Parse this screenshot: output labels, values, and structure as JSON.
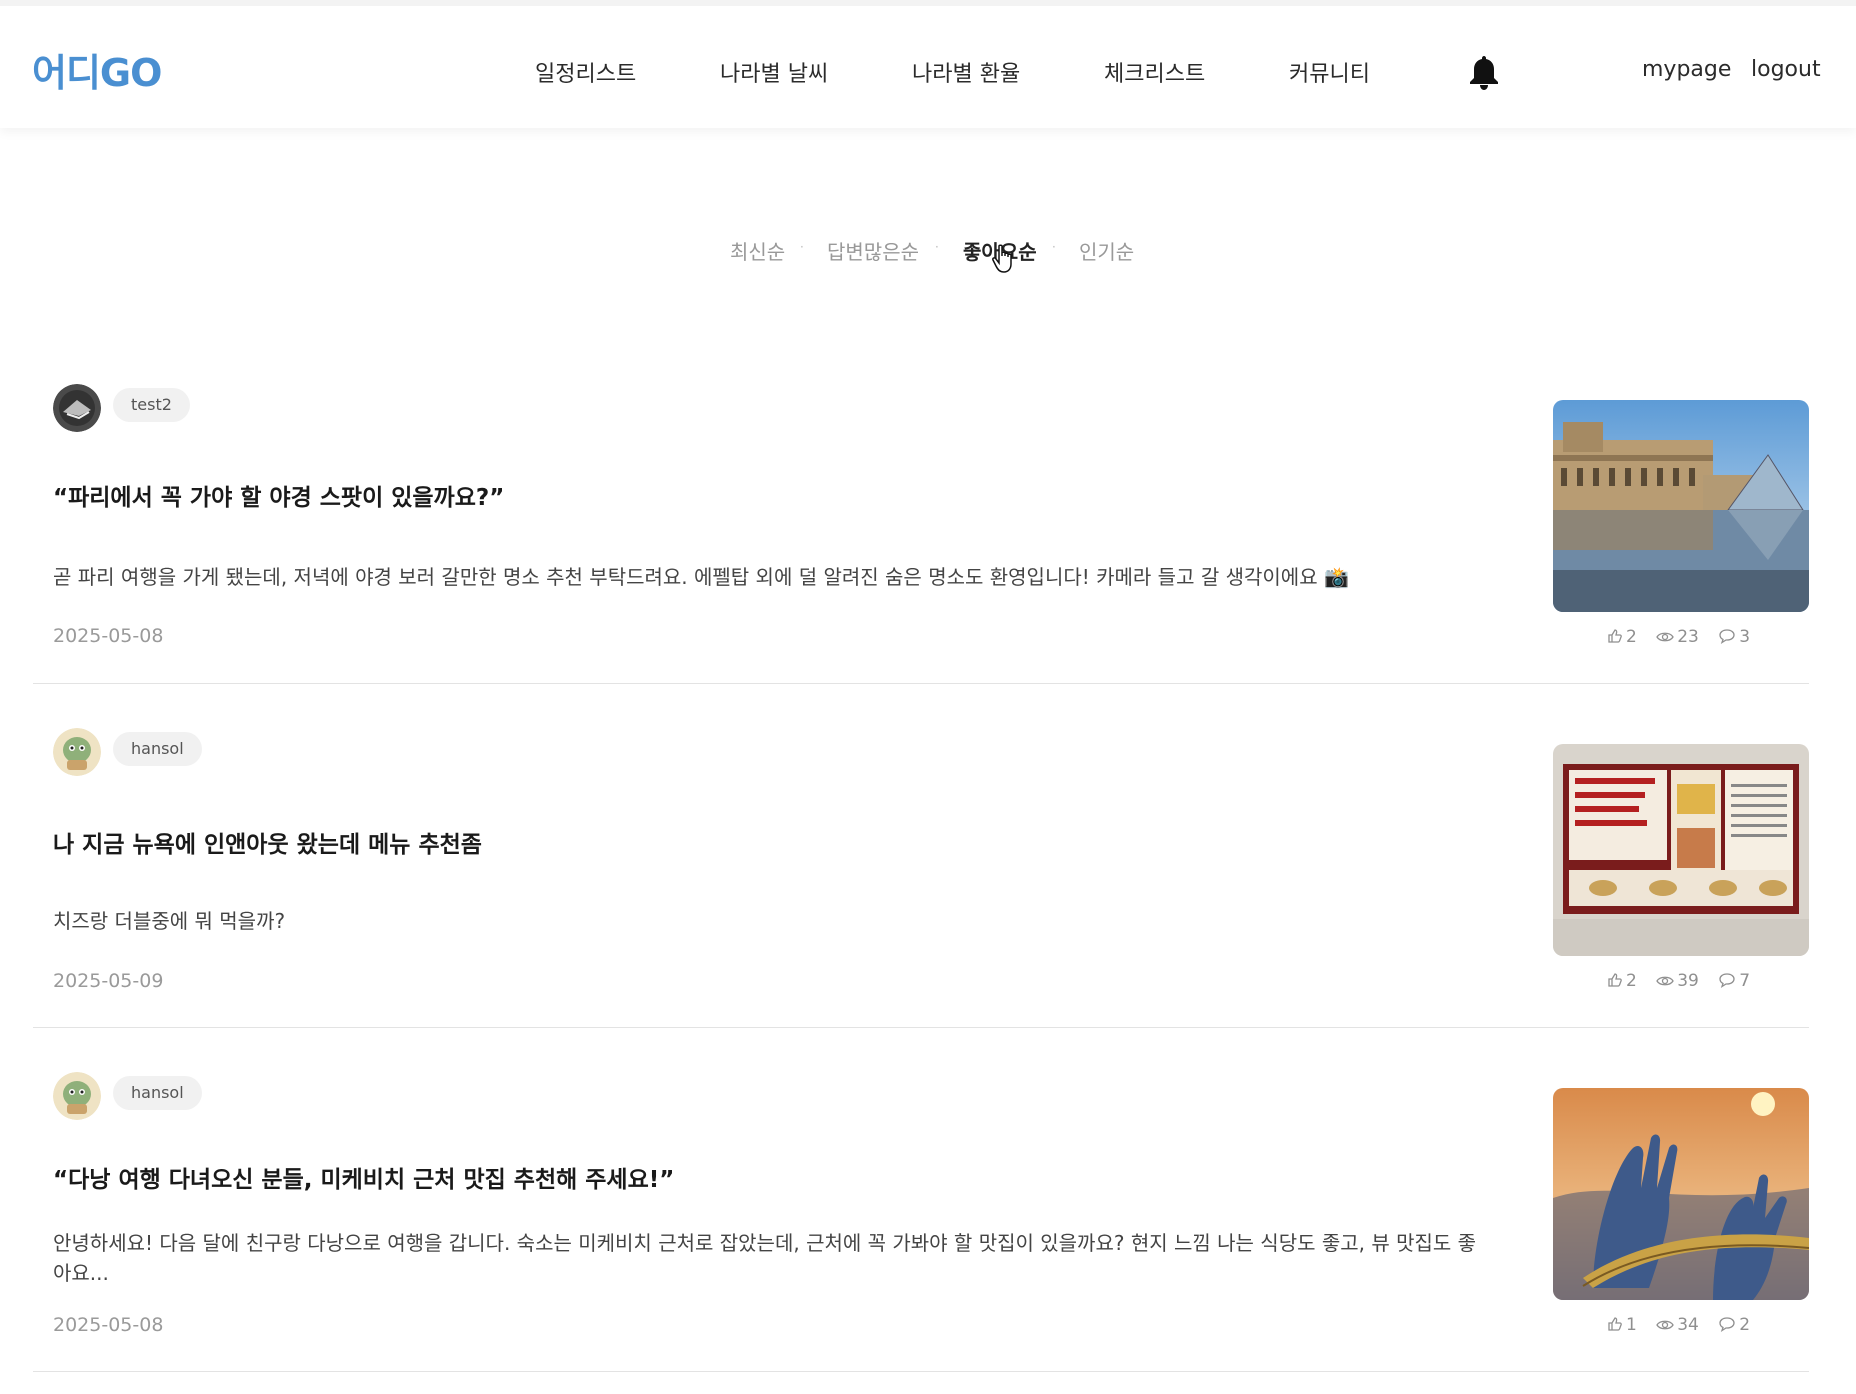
{
  "header": {
    "logo": "어디GO",
    "nav": [
      "일정리스트",
      "나라별 날씨",
      "나라별 환율",
      "체크리스트",
      "커뮤니티"
    ],
    "mypage": "mypage",
    "logout": "logout",
    "bell_icon": "bell-icon"
  },
  "sort": {
    "options": [
      "최신순",
      "답변많은순",
      "좋아요순",
      "인기순"
    ],
    "active": "좋아요순"
  },
  "posts": [
    {
      "user": "test2",
      "title": "“파리에서 꼭 가야 할 야경 스팟이 있을까요?”",
      "body": "곧 파리 여행을 가게 됐는데, 저녁에 야경 보러 갈만한 명소 추천 부탁드려요. 에펠탑 외에 덜 알려진 숨은 명소도 환영입니다! 카메라 들고 갈 생각이에요 📸",
      "date": "2025-05-08",
      "likes": "2",
      "views": "23",
      "comments": "3"
    },
    {
      "user": "hansol",
      "title": "나 지금 뉴욕에 인앤아웃 왔는데 메뉴 추천좀",
      "body": "치즈랑 더블중에 뭐 먹을까?",
      "date": "2025-05-09",
      "likes": "2",
      "views": "39",
      "comments": "7"
    },
    {
      "user": "hansol",
      "title": "“다낭 여행 다녀오신 분들, 미케비치 근처 맛집 추천해 주세요!”",
      "body": "안녕하세요! 다음 달에 친구랑 다낭으로 여행을 갑니다. 숙소는 미케비치 근처로 잡았는데, 근처에 꼭 가봐야 할 맛집이 있을까요? 현지 느낌 나는 식당도 좋고, 뷰 맛집도 좋아요...",
      "date": "2025-05-08",
      "likes": "1",
      "views": "34",
      "comments": "2"
    }
  ]
}
